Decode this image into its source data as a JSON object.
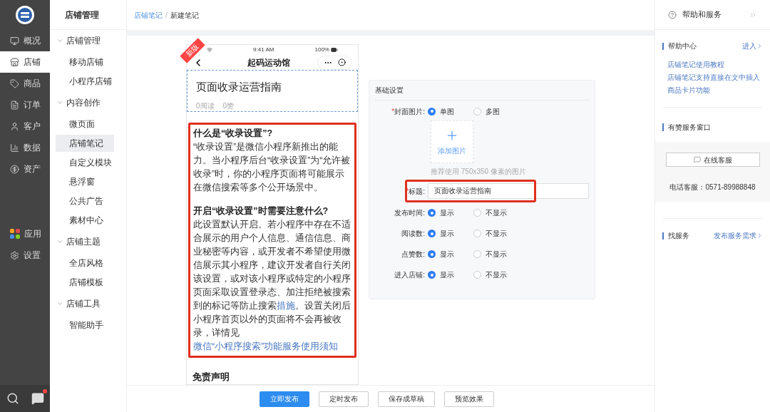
{
  "nav": [
    {
      "label": "概况",
      "selected": false
    },
    {
      "label": "店铺",
      "selected": true
    },
    {
      "label": "商品",
      "selected": false
    },
    {
      "label": "订单",
      "selected": false
    },
    {
      "label": "客户",
      "selected": false
    },
    {
      "label": "数据",
      "selected": false
    },
    {
      "label": "资产",
      "selected": false
    },
    {
      "label": "应用",
      "selected": false
    },
    {
      "label": "设置",
      "selected": false
    }
  ],
  "messages": {
    "unread": true
  },
  "subnav": {
    "title": "店铺管理",
    "groups": [
      {
        "label": "店铺管理",
        "expanded": true,
        "items": [
          {
            "label": "移动店铺",
            "selected": false
          },
          {
            "label": "小程序店铺",
            "selected": false
          }
        ]
      },
      {
        "label": "内容创作",
        "expanded": true,
        "items": [
          {
            "label": "微页面",
            "selected": false
          },
          {
            "label": "店铺笔记",
            "selected": true
          },
          {
            "label": "自定义模块",
            "selected": false
          },
          {
            "label": "悬浮窗",
            "selected": false
          },
          {
            "label": "公共广告",
            "selected": false
          },
          {
            "label": "素材中心",
            "selected": false
          }
        ]
      },
      {
        "label": "店铺主题",
        "expanded": true,
        "items": [
          {
            "label": "全店风格",
            "selected": false
          },
          {
            "label": "店铺模板",
            "selected": false
          }
        ]
      },
      {
        "label": "店铺工具",
        "expanded": true,
        "items": [
          {
            "label": "智能助手",
            "selected": false
          }
        ]
      }
    ]
  },
  "breadcrumb": [
    "店铺笔记",
    "/",
    "新建笔记"
  ],
  "phone": {
    "ribbon": "新版",
    "time": "9:41 AM",
    "battery": "100%",
    "title": "起码运动馆",
    "note_title": "页面收录运营指南",
    "reads": "0阅读",
    "likes": "0赞",
    "highlight": true,
    "blocks": [
      {
        "kind": "heading",
        "text": "什么是“收录设置”?"
      },
      {
        "kind": "paragraph",
        "parts": [
          {
            "text": "“收录设置”是微信小程序新推出的能力。当小程序后台“收录设置”为“允许被收录”时，你的小程序页面将可能展示在微信搜索等多个公开场景中。",
            "link": false
          }
        ]
      },
      {
        "kind": "heading",
        "text": "开启“收录设置”时需要注意什么?"
      },
      {
        "kind": "paragraph",
        "parts": [
          {
            "text": "此设置默认开启。若小程序中存在不适合展示的用户个人信息、通信信息、商业秘密等内容，或开发者不希望使用微信展示其小程序，建议开发者自行关闭该设置，或对该小程序或特定的小程序页面采取设置登录态、加注拒绝被搜索到的标记等防止搜索",
            "link": false
          },
          {
            "text": "措施",
            "link": true
          },
          {
            "text": "。设置关闭后小程序首页以外的页面将不会再被收录，详情见",
            "link": false
          },
          {
            "text": "微信“小程序搜索”功能服务使用须知",
            "link": true
          }
        ]
      }
    ],
    "after": {
      "heading": "免责声明"
    }
  },
  "settings": {
    "title": "基础设置",
    "rows": [
      {
        "kind": "radio",
        "label": "封面图片:",
        "required": "*",
        "options": [
          {
            "label": "单图",
            "selected": true
          },
          {
            "label": "多图",
            "selected": false
          }
        ]
      },
      {
        "kind": "upload",
        "label_text": "添加图片",
        "hint": "推荐使用 750x350 像素的图片"
      },
      {
        "kind": "input",
        "label": "标题:",
        "required": "*",
        "value": "页面收录运营指南",
        "highlight": true
      },
      {
        "kind": "radio",
        "label": "发布时间:",
        "options": [
          {
            "label": "显示",
            "selected": true
          },
          {
            "label": "不显示",
            "selected": false
          }
        ]
      },
      {
        "kind": "radio",
        "label": "阅读数:",
        "options": [
          {
            "label": "显示",
            "selected": true
          },
          {
            "label": "不显示",
            "selected": false
          }
        ]
      },
      {
        "kind": "radio",
        "label": "点赞数:",
        "options": [
          {
            "label": "显示",
            "selected": true
          },
          {
            "label": "不显示",
            "selected": false
          }
        ]
      },
      {
        "kind": "radio",
        "label": "进入店铺:",
        "options": [
          {
            "label": "显示",
            "selected": true
          },
          {
            "label": "不显示",
            "selected": false
          }
        ]
      }
    ]
  },
  "actions": [
    {
      "label": "立即发布",
      "primary": true
    },
    {
      "label": "定时发布",
      "primary": false
    },
    {
      "label": "保存成草稿",
      "primary": false
    },
    {
      "label": "预览效果",
      "primary": false
    }
  ],
  "help": {
    "title": "帮助和服务",
    "center": {
      "title": "帮助中心",
      "enter": "进入",
      "links": [
        "店铺笔记使用教程",
        "店铺笔记支持直接在文中插入商品卡片功能"
      ]
    },
    "window": {
      "title": "有赞服务窗口",
      "button": "在线客服",
      "phone": "电话客服：0571-89988848"
    },
    "service": {
      "title": "找服务",
      "link": "发布服务需求"
    }
  }
}
